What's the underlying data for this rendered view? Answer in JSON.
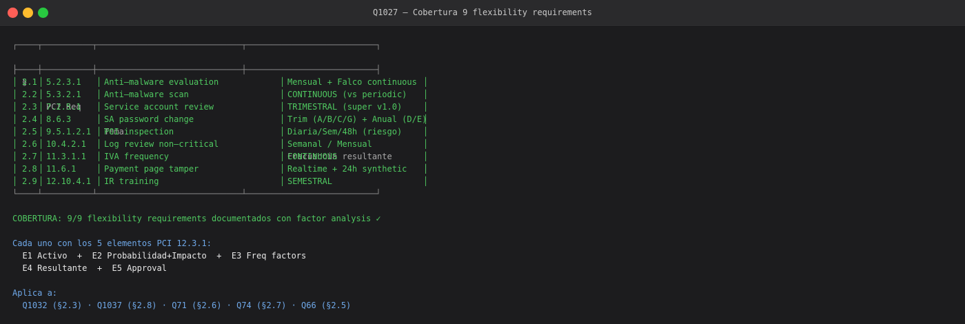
{
  "window": {
    "title": "Q1027 — Cobertura 9 flexibility requirements"
  },
  "table": {
    "border_top": "┌────┬──────────┬─────────────────────────────┬──────────────────────────┐",
    "border_mid": "├────┼──────────┼─────────────────────────────┼──────────────────────────┤",
    "border_bottom": "└────┴──────────┴─────────────────────────────┴──────────────────────────┘",
    "header": {
      "sec": "§",
      "req": "PCI Req",
      "tema": "Tema",
      "freq": "Frecuencia resultante"
    },
    "rows": [
      {
        "sec": "2.1",
        "req": "5.2.3.1",
        "tema": "Anti–malware evaluation",
        "freq": "Mensual + Falco continuous"
      },
      {
        "sec": "2.2",
        "req": "5.3.2.1",
        "tema": "Anti–malware scan",
        "freq": "CONTINUOUS (vs periodic)"
      },
      {
        "sec": "2.3",
        "req": "7.2.5.1",
        "tema": "Service account review",
        "freq": "TRIMESTRAL (super v1.0)"
      },
      {
        "sec": "2.4",
        "req": "8.6.3",
        "tema": "SA password change",
        "freq": "Trim (A/B/C/G) + Anual (D/E)"
      },
      {
        "sec": "2.5",
        "req": "9.5.1.2.1",
        "tema": "POI inspection",
        "freq": "Diaria/Sem/48h (riesgo)"
      },
      {
        "sec": "2.6",
        "req": "10.4.2.1",
        "tema": "Log review non–critical",
        "freq": "Semanal / Mensual"
      },
      {
        "sec": "2.7",
        "req": "11.3.1.1",
        "tema": "IVA frequency",
        "freq": "CONTINUOUS"
      },
      {
        "sec": "2.8",
        "req": "11.6.1",
        "tema": "Payment page tamper",
        "freq": "Realtime + 24h synthetic"
      },
      {
        "sec": "2.9",
        "req": "12.10.4.1",
        "tema": "IR training",
        "freq": "SEMESTRAL"
      }
    ]
  },
  "summary": {
    "cobertura": "COBERTURA: 9/9 flexibility requirements documentados con factor analysis ✓",
    "elements_heading": "Cada uno con los 5 elementos PCI 12.3.1:",
    "elements_line1": "  E1 Activo  +  E2 Probabilidad+Impacto  +  E3 Freq factors",
    "elements_line2": "  E4 Resultante  +  E5 Approval",
    "aplica_heading": "Aplica a:",
    "aplica_line": "  Q1032 (§2.3) · Q1037 (§2.8) · Q71 (§2.6) · Q74 (§2.7) · Q66 (§2.5)"
  }
}
